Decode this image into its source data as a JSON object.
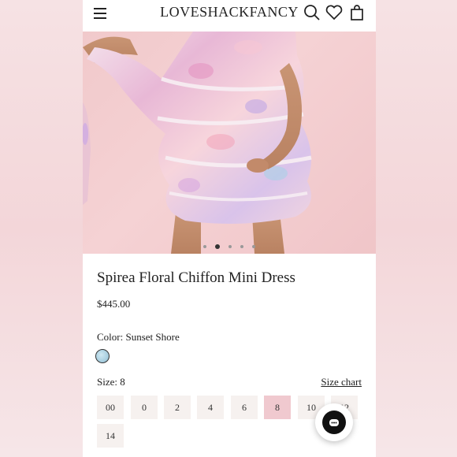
{
  "header": {
    "brand": "LOVESHACKFANCY",
    "icons": [
      "menu-icon",
      "search-icon",
      "heart-icon",
      "bag-icon"
    ]
  },
  "gallery": {
    "dot_count": 5,
    "active_index": 1
  },
  "product": {
    "title": "Spirea Floral Chiffon Mini Dress",
    "price": "$445.00",
    "color_label": "Color: Sunset Shore",
    "size_label": "Size: 8",
    "size_chart": "Size chart",
    "sizes": [
      "00",
      "0",
      "2",
      "4",
      "6",
      "8",
      "10",
      "12",
      "14"
    ],
    "selected_size": "8"
  },
  "colors": {
    "accent": "#f0c9cf",
    "background": "#f3d6d9"
  },
  "chat": {
    "icon": "chat-icon"
  }
}
